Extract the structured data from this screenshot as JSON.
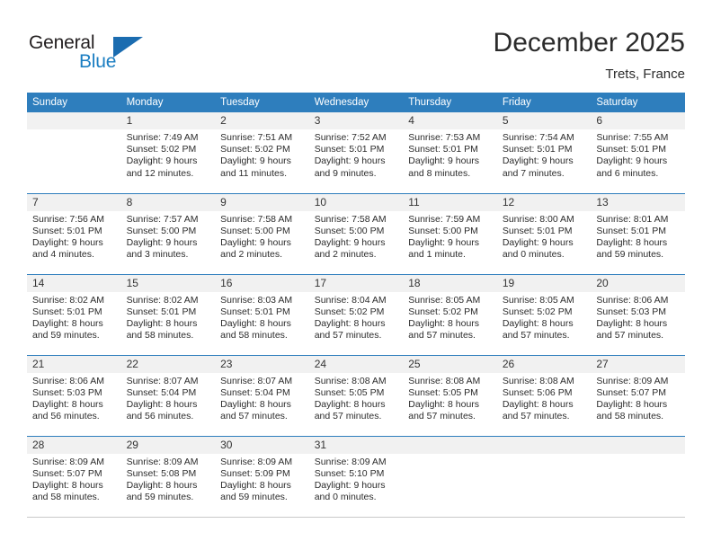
{
  "brand": {
    "name_part1": "General",
    "name_part2": "Blue",
    "logo_icon": "triangle-flag-icon"
  },
  "header": {
    "title": "December 2025",
    "subtitle": "Trets, France"
  },
  "calendar": {
    "weekday_headers": [
      "Sunday",
      "Monday",
      "Tuesday",
      "Wednesday",
      "Thursday",
      "Friday",
      "Saturday"
    ],
    "colors": {
      "header_blue": "#2e7ebd",
      "daynum_bg": "#f1f1f1",
      "text": "#2c2c2c",
      "brand_blue": "#1b7ec2"
    },
    "weeks": [
      [
        {
          "day": "",
          "sunrise": "",
          "sunset": "",
          "daylight_line1": "",
          "daylight_line2": ""
        },
        {
          "day": "1",
          "sunrise": "Sunrise: 7:49 AM",
          "sunset": "Sunset: 5:02 PM",
          "daylight_line1": "Daylight: 9 hours",
          "daylight_line2": "and 12 minutes."
        },
        {
          "day": "2",
          "sunrise": "Sunrise: 7:51 AM",
          "sunset": "Sunset: 5:02 PM",
          "daylight_line1": "Daylight: 9 hours",
          "daylight_line2": "and 11 minutes."
        },
        {
          "day": "3",
          "sunrise": "Sunrise: 7:52 AM",
          "sunset": "Sunset: 5:01 PM",
          "daylight_line1": "Daylight: 9 hours",
          "daylight_line2": "and 9 minutes."
        },
        {
          "day": "4",
          "sunrise": "Sunrise: 7:53 AM",
          "sunset": "Sunset: 5:01 PM",
          "daylight_line1": "Daylight: 9 hours",
          "daylight_line2": "and 8 minutes."
        },
        {
          "day": "5",
          "sunrise": "Sunrise: 7:54 AM",
          "sunset": "Sunset: 5:01 PM",
          "daylight_line1": "Daylight: 9 hours",
          "daylight_line2": "and 7 minutes."
        },
        {
          "day": "6",
          "sunrise": "Sunrise: 7:55 AM",
          "sunset": "Sunset: 5:01 PM",
          "daylight_line1": "Daylight: 9 hours",
          "daylight_line2": "and 6 minutes."
        }
      ],
      [
        {
          "day": "7",
          "sunrise": "Sunrise: 7:56 AM",
          "sunset": "Sunset: 5:01 PM",
          "daylight_line1": "Daylight: 9 hours",
          "daylight_line2": "and 4 minutes."
        },
        {
          "day": "8",
          "sunrise": "Sunrise: 7:57 AM",
          "sunset": "Sunset: 5:00 PM",
          "daylight_line1": "Daylight: 9 hours",
          "daylight_line2": "and 3 minutes."
        },
        {
          "day": "9",
          "sunrise": "Sunrise: 7:58 AM",
          "sunset": "Sunset: 5:00 PM",
          "daylight_line1": "Daylight: 9 hours",
          "daylight_line2": "and 2 minutes."
        },
        {
          "day": "10",
          "sunrise": "Sunrise: 7:58 AM",
          "sunset": "Sunset: 5:00 PM",
          "daylight_line1": "Daylight: 9 hours",
          "daylight_line2": "and 2 minutes."
        },
        {
          "day": "11",
          "sunrise": "Sunrise: 7:59 AM",
          "sunset": "Sunset: 5:00 PM",
          "daylight_line1": "Daylight: 9 hours",
          "daylight_line2": "and 1 minute."
        },
        {
          "day": "12",
          "sunrise": "Sunrise: 8:00 AM",
          "sunset": "Sunset: 5:01 PM",
          "daylight_line1": "Daylight: 9 hours",
          "daylight_line2": "and 0 minutes."
        },
        {
          "day": "13",
          "sunrise": "Sunrise: 8:01 AM",
          "sunset": "Sunset: 5:01 PM",
          "daylight_line1": "Daylight: 8 hours",
          "daylight_line2": "and 59 minutes."
        }
      ],
      [
        {
          "day": "14",
          "sunrise": "Sunrise: 8:02 AM",
          "sunset": "Sunset: 5:01 PM",
          "daylight_line1": "Daylight: 8 hours",
          "daylight_line2": "and 59 minutes."
        },
        {
          "day": "15",
          "sunrise": "Sunrise: 8:02 AM",
          "sunset": "Sunset: 5:01 PM",
          "daylight_line1": "Daylight: 8 hours",
          "daylight_line2": "and 58 minutes."
        },
        {
          "day": "16",
          "sunrise": "Sunrise: 8:03 AM",
          "sunset": "Sunset: 5:01 PM",
          "daylight_line1": "Daylight: 8 hours",
          "daylight_line2": "and 58 minutes."
        },
        {
          "day": "17",
          "sunrise": "Sunrise: 8:04 AM",
          "sunset": "Sunset: 5:02 PM",
          "daylight_line1": "Daylight: 8 hours",
          "daylight_line2": "and 57 minutes."
        },
        {
          "day": "18",
          "sunrise": "Sunrise: 8:05 AM",
          "sunset": "Sunset: 5:02 PM",
          "daylight_line1": "Daylight: 8 hours",
          "daylight_line2": "and 57 minutes."
        },
        {
          "day": "19",
          "sunrise": "Sunrise: 8:05 AM",
          "sunset": "Sunset: 5:02 PM",
          "daylight_line1": "Daylight: 8 hours",
          "daylight_line2": "and 57 minutes."
        },
        {
          "day": "20",
          "sunrise": "Sunrise: 8:06 AM",
          "sunset": "Sunset: 5:03 PM",
          "daylight_line1": "Daylight: 8 hours",
          "daylight_line2": "and 57 minutes."
        }
      ],
      [
        {
          "day": "21",
          "sunrise": "Sunrise: 8:06 AM",
          "sunset": "Sunset: 5:03 PM",
          "daylight_line1": "Daylight: 8 hours",
          "daylight_line2": "and 56 minutes."
        },
        {
          "day": "22",
          "sunrise": "Sunrise: 8:07 AM",
          "sunset": "Sunset: 5:04 PM",
          "daylight_line1": "Daylight: 8 hours",
          "daylight_line2": "and 56 minutes."
        },
        {
          "day": "23",
          "sunrise": "Sunrise: 8:07 AM",
          "sunset": "Sunset: 5:04 PM",
          "daylight_line1": "Daylight: 8 hours",
          "daylight_line2": "and 57 minutes."
        },
        {
          "day": "24",
          "sunrise": "Sunrise: 8:08 AM",
          "sunset": "Sunset: 5:05 PM",
          "daylight_line1": "Daylight: 8 hours",
          "daylight_line2": "and 57 minutes."
        },
        {
          "day": "25",
          "sunrise": "Sunrise: 8:08 AM",
          "sunset": "Sunset: 5:05 PM",
          "daylight_line1": "Daylight: 8 hours",
          "daylight_line2": "and 57 minutes."
        },
        {
          "day": "26",
          "sunrise": "Sunrise: 8:08 AM",
          "sunset": "Sunset: 5:06 PM",
          "daylight_line1": "Daylight: 8 hours",
          "daylight_line2": "and 57 minutes."
        },
        {
          "day": "27",
          "sunrise": "Sunrise: 8:09 AM",
          "sunset": "Sunset: 5:07 PM",
          "daylight_line1": "Daylight: 8 hours",
          "daylight_line2": "and 58 minutes."
        }
      ],
      [
        {
          "day": "28",
          "sunrise": "Sunrise: 8:09 AM",
          "sunset": "Sunset: 5:07 PM",
          "daylight_line1": "Daylight: 8 hours",
          "daylight_line2": "and 58 minutes."
        },
        {
          "day": "29",
          "sunrise": "Sunrise: 8:09 AM",
          "sunset": "Sunset: 5:08 PM",
          "daylight_line1": "Daylight: 8 hours",
          "daylight_line2": "and 59 minutes."
        },
        {
          "day": "30",
          "sunrise": "Sunrise: 8:09 AM",
          "sunset": "Sunset: 5:09 PM",
          "daylight_line1": "Daylight: 8 hours",
          "daylight_line2": "and 59 minutes."
        },
        {
          "day": "31",
          "sunrise": "Sunrise: 8:09 AM",
          "sunset": "Sunset: 5:10 PM",
          "daylight_line1": "Daylight: 9 hours",
          "daylight_line2": "and 0 minutes."
        },
        {
          "day": "",
          "sunrise": "",
          "sunset": "",
          "daylight_line1": "",
          "daylight_line2": ""
        },
        {
          "day": "",
          "sunrise": "",
          "sunset": "",
          "daylight_line1": "",
          "daylight_line2": ""
        },
        {
          "day": "",
          "sunrise": "",
          "sunset": "",
          "daylight_line1": "",
          "daylight_line2": ""
        }
      ]
    ]
  }
}
